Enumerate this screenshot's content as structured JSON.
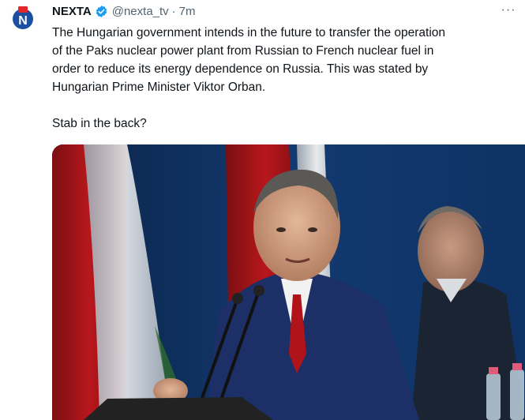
{
  "author": {
    "name": "NEXTA",
    "handle": "@nexta_tv",
    "separator": "·",
    "time": "7m",
    "avatar_icon": "nexta-logo-icon",
    "verified_icon": "verified-badge-icon"
  },
  "tweet": {
    "lines": [
      "The Hungarian government intends in the future to transfer the operation",
      "of the Paks nuclear power plant from Russian to French nuclear fuel in",
      "order to reduce its energy dependence on Russia. This was stated by",
      "Hungarian Prime Minister Viktor Orban."
    ],
    "question": "Stab in the back?"
  },
  "menu": {
    "icon": "more-options-icon",
    "glyph": "···"
  },
  "colors": {
    "text": "#0f1419",
    "secondary": "#536471",
    "verified": "#1d9bf0",
    "logo_red": "#e3262b",
    "logo_blue": "#1b4fa0"
  }
}
